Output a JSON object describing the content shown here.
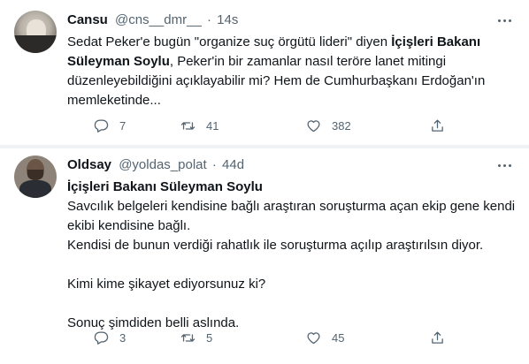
{
  "tweets": [
    {
      "name": "Cansu",
      "handle": "@cns__dmr__",
      "dot": "·",
      "time": "14s",
      "lines": [
        {
          "parts": [
            {
              "t": "Sedat Peker'e bugün \"organize suç örgütü lideri\" diyen ",
              "b": false
            },
            {
              "t": "İçişleri Bakanı",
              "b": true
            }
          ]
        },
        {
          "parts": [
            {
              "t": "Süleyman Soylu",
              "b": true
            },
            {
              "t": ", Peker'in bir zamanlar nasıl teröre lanet mitingi",
              "b": false
            }
          ]
        },
        {
          "parts": [
            {
              "t": "düzenleyebildiğini açıklayabilir mi? Hem de Cumhurbaşkanı Erdoğan'ın",
              "b": false
            }
          ]
        },
        {
          "parts": [
            {
              "t": "memleketinde...",
              "b": false
            }
          ]
        }
      ],
      "counts": {
        "replies": "7",
        "retweets": "41",
        "likes": "382"
      }
    },
    {
      "name": "Oldsay",
      "handle": "@yoldas_polat",
      "dot": "·",
      "time": "44d",
      "lines": [
        {
          "parts": [
            {
              "t": "İçişleri Bakanı Süleyman Soylu",
              "b": true
            }
          ]
        },
        {
          "parts": [
            {
              "t": "Savcılık belgeleri kendisine bağlı araştıran soruşturma açan ekip gene  kendi",
              "b": false
            }
          ]
        },
        {
          "parts": [
            {
              "t": "ekibi kendisine bağlı.",
              "b": false
            }
          ]
        },
        {
          "parts": [
            {
              "t": "Kendisi de bunun verdiği rahatlık ile soruşturma açılıp araştırılsın diyor.",
              "b": false
            }
          ]
        },
        {
          "parts": []
        },
        {
          "parts": [
            {
              "t": "Kimi kime şikayet ediyorsunuz ki?",
              "b": false
            }
          ]
        },
        {
          "parts": []
        },
        {
          "parts": [
            {
              "t": "Sonuç şimdiden belli aslında.",
              "b": false
            }
          ]
        }
      ],
      "counts": {
        "replies": "3",
        "retweets": "5",
        "likes": "45"
      }
    }
  ],
  "icons": {
    "reply": "reply-icon",
    "retweet": "retweet-icon",
    "like": "heart-icon",
    "share": "share-icon",
    "more": "more-icon"
  },
  "colors": {
    "text": "#0f1419",
    "muted": "#536471",
    "separator": "#eff3f4"
  }
}
